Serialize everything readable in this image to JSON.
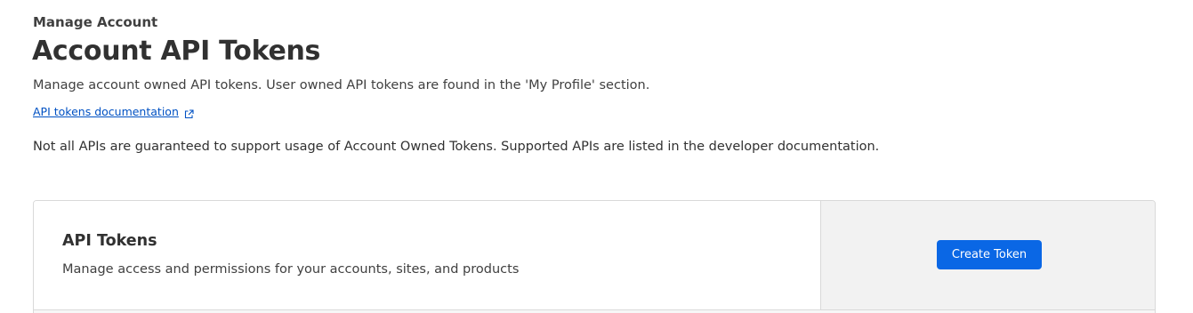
{
  "header": {
    "eyebrow": "Manage Account",
    "title": "Account API Tokens",
    "subtitle": "Manage account owned API tokens. User owned API tokens are found in the 'My Profile' section.",
    "doc_link_label": "API tokens documentation",
    "doc_link_icon": "external-link-icon",
    "notice": "Not all APIs are guaranteed to support usage of Account Owned Tokens. Supported APIs are listed in the developer documentation."
  },
  "tokens_card": {
    "title": "API Tokens",
    "description": "Manage access and permissions for your accounts, sites, and products",
    "create_button_label": "Create Token"
  },
  "colors": {
    "link": "#0051c3",
    "primary_button": "#0a67e5",
    "side_panel": "#f2f2f2",
    "border": "#d9d9d9"
  }
}
